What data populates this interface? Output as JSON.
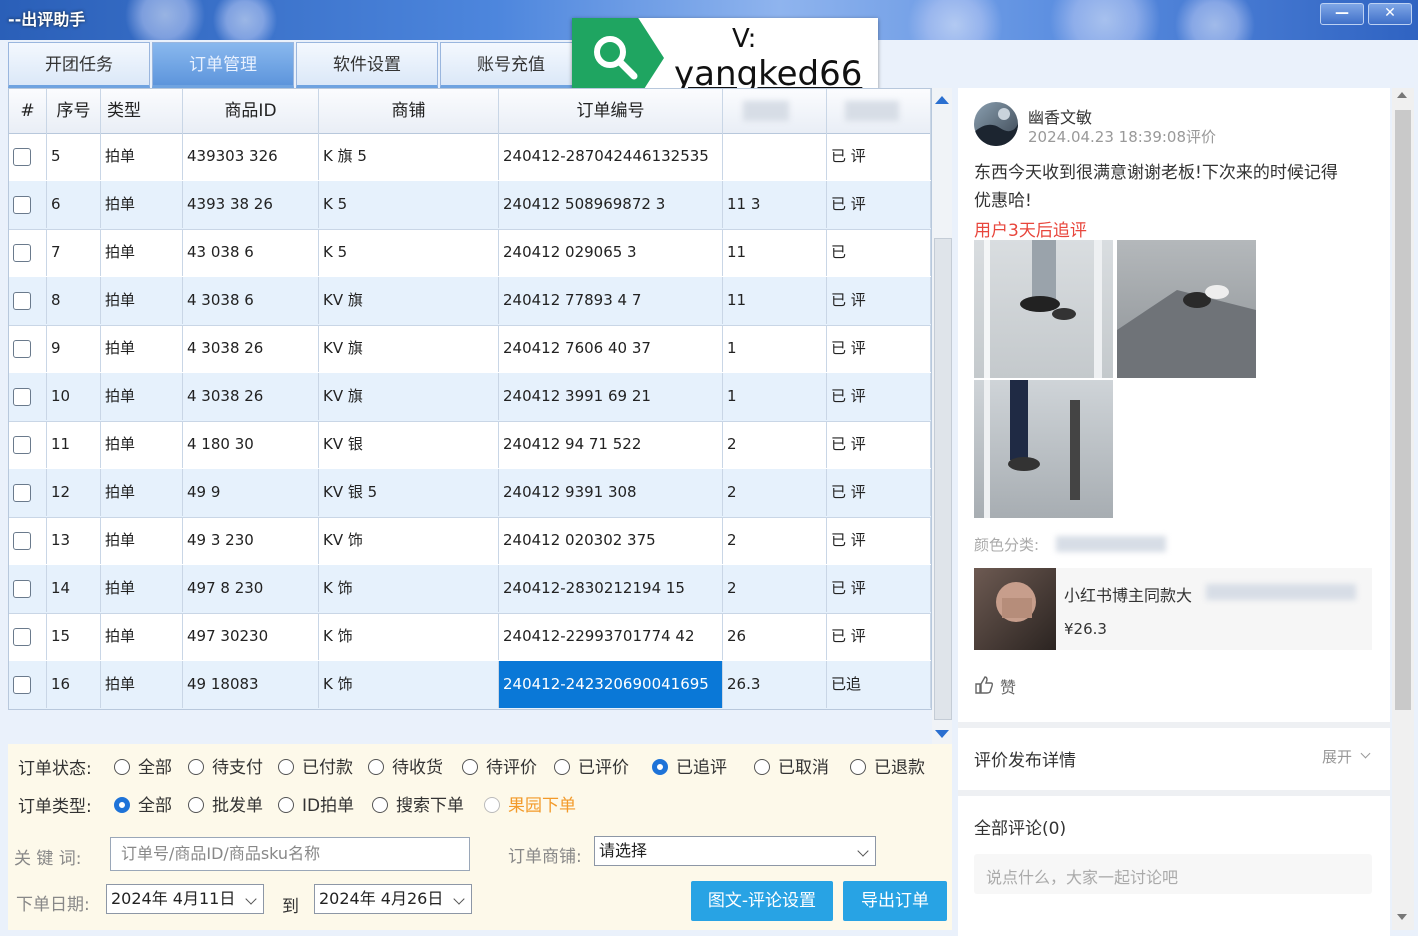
{
  "window": {
    "title": "--出评助手"
  },
  "tabs": [
    {
      "label": "开团任务"
    },
    {
      "label": "订单管理"
    },
    {
      "label": "软件设置"
    },
    {
      "label": "账号充值"
    }
  ],
  "watermark": {
    "line1": "V:",
    "line2": "yangked66"
  },
  "grid": {
    "headers": [
      "#",
      "序号",
      "类型",
      "商品ID",
      "商铺",
      "订单编号"
    ],
    "rows": [
      {
        "seq": "5",
        "type": "拍单",
        "pid": "439303 326",
        "shop": "K 旗 5",
        "order": "240412-287042446132535",
        "amount": "",
        "status": "已 评"
      },
      {
        "seq": "6",
        "type": "拍单",
        "pid": "4393 38 26",
        "shop": "K 5",
        "order": "240412 508969872 3",
        "amount": "11 3",
        "status": "已 评"
      },
      {
        "seq": "7",
        "type": "拍单",
        "pid": "43 038 6",
        "shop": "K 5",
        "order": "240412 029065 3",
        "amount": "11",
        "status": "已"
      },
      {
        "seq": "8",
        "type": "拍单",
        "pid": "4 3038 6",
        "shop": "KV 旗",
        "order": "240412 77893 4 7",
        "amount": "11",
        "status": "已 评"
      },
      {
        "seq": "9",
        "type": "拍单",
        "pid": "4 3038 26",
        "shop": "KV 旗",
        "order": "240412 7606 40 37",
        "amount": "1",
        "status": "已 评"
      },
      {
        "seq": "10",
        "type": "拍单",
        "pid": "4 3038 26",
        "shop": "KV 旗",
        "order": "240412 3991 69 21",
        "amount": "1",
        "status": "已 评"
      },
      {
        "seq": "11",
        "type": "拍单",
        "pid": "4 180 30",
        "shop": "KV 银",
        "order": "240412 94 71 522",
        "amount": "2",
        "status": "已 评"
      },
      {
        "seq": "12",
        "type": "拍单",
        "pid": "49 9",
        "shop": "KV 银 5",
        "order": "240412 9391 308",
        "amount": "2",
        "status": "已 评"
      },
      {
        "seq": "13",
        "type": "拍单",
        "pid": "49 3 230",
        "shop": "KV 饰",
        "order": "240412 020302 375",
        "amount": "2",
        "status": "已 评"
      },
      {
        "seq": "14",
        "type": "拍单",
        "pid": "497 8 230",
        "shop": "K 饰",
        "order": "240412-2830212194 15",
        "amount": "2",
        "status": "已 评"
      },
      {
        "seq": "15",
        "type": "拍单",
        "pid": "497 30230",
        "shop": "K 饰",
        "order": "240412-22993701774 42",
        "amount": "26",
        "status": "已 评"
      },
      {
        "seq": "16",
        "type": "拍单",
        "pid": "49 18083",
        "shop": "K 饰",
        "order": "240412-242320690041695",
        "amount": "26.3",
        "status": "已追"
      }
    ]
  },
  "filters": {
    "status_label": "订单状态:",
    "status_options": [
      "全部",
      "待支付",
      "已付款",
      "待收货",
      "待评价",
      "已评价",
      "已追评",
      "已取消",
      "已退款"
    ],
    "status_selected": "已追评",
    "type_label": "订单类型:",
    "type_options": [
      "全部",
      "批发单",
      "ID拍单",
      "搜索下单",
      "果园下单"
    ],
    "type_selected": "全部",
    "keyword_label": "关 键 词:",
    "keyword_placeholder": "订单号/商品ID/商品sku名称",
    "shop_label": "订单商铺:",
    "shop_value": "请选择",
    "date_label": "下单日期:",
    "date_from": "2024年 4月11日",
    "date_to_label": "到",
    "date_to": "2024年 4月26日",
    "btn_settings": "图文-评论设置",
    "btn_export": "导出订单"
  },
  "review": {
    "username": "幽香文敏",
    "time": "2024.04.23 18:39:08评价",
    "text_line1": "东西今天收到很满意谢谢老板!下次来的时候记得",
    "text_line2": "优惠哈!",
    "followup": "用户3天后追评",
    "color_label": "颜色分类:",
    "product_title": "小红书博主同款大",
    "product_price": "¥26.3",
    "like_label": "赞",
    "publish_detail": "评价发布详情",
    "expand_label": "展开",
    "comments_label": "全部评论(0)",
    "comment_placeholder": "说点什么，大家一起讨论吧"
  },
  "colors": {
    "accent": "#28a3e4",
    "selected_row": "#0a78d7",
    "followup": "#e8463c",
    "alt_row": "#e6f1fc"
  }
}
